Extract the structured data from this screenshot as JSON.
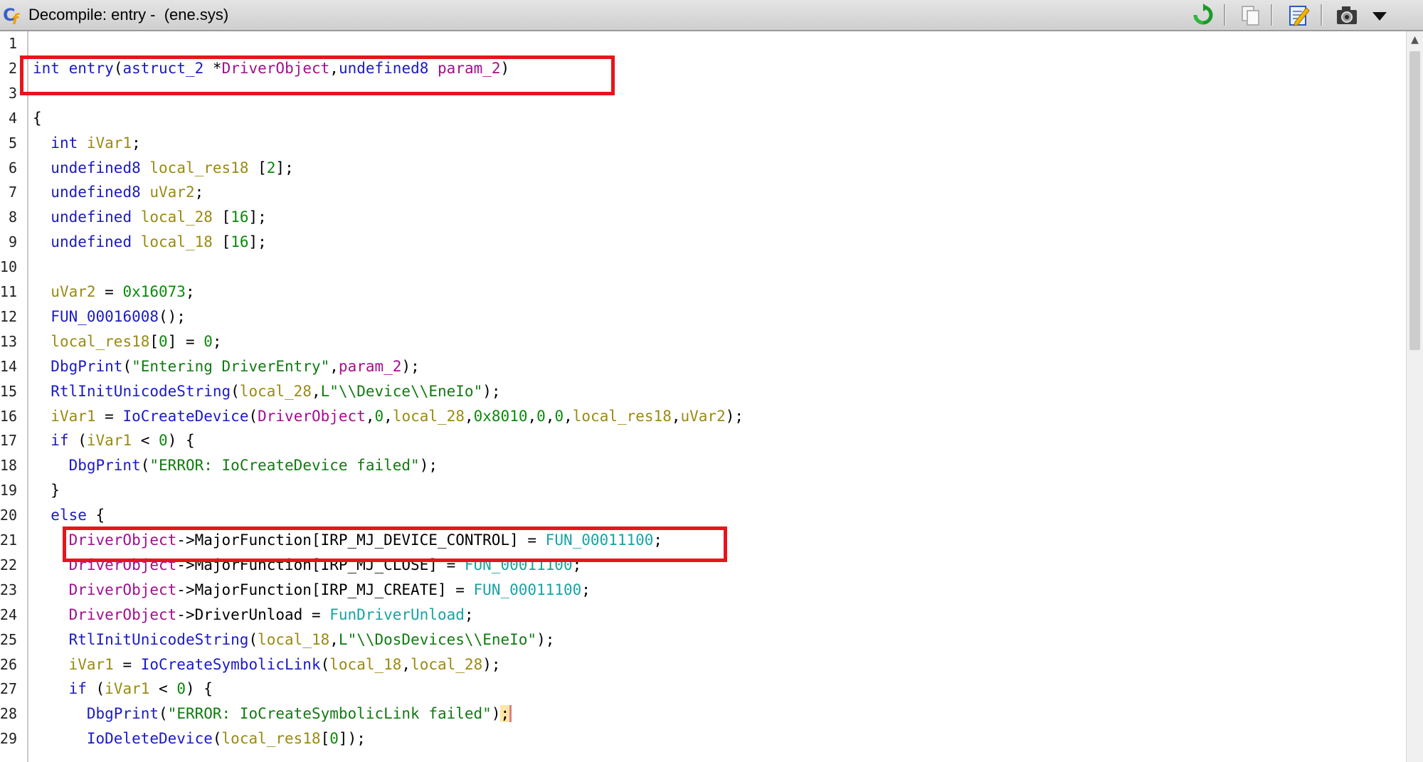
{
  "window": {
    "title": "Decompile: entry -  (ene.sys)"
  },
  "toolbar": {
    "icons": [
      "refresh-icon",
      "copy-icon",
      "edit-icon",
      "snapshot-icon",
      "menu-dropdown-icon"
    ]
  },
  "editor": {
    "line_numbers": [
      "1",
      "2",
      "3",
      "4",
      "5",
      "6",
      "7",
      "8",
      "9",
      "10",
      "11",
      "12",
      "13",
      "14",
      "15",
      "16",
      "17",
      "18",
      "19",
      "20",
      "21",
      "22",
      "23",
      "24",
      "25",
      "26",
      "27",
      "28",
      "29"
    ],
    "lines": [
      [],
      [
        [
          "int",
          "kw"
        ],
        [
          " ",
          "plain"
        ],
        [
          "entry",
          "fn"
        ],
        [
          "(",
          "plain"
        ],
        [
          "astruct_2",
          "type"
        ],
        [
          " *",
          "plain"
        ],
        [
          "DriverObject",
          "param"
        ],
        [
          ",",
          "plain"
        ],
        [
          "undefined8",
          "type"
        ],
        [
          " ",
          "plain"
        ],
        [
          "param_2",
          "param"
        ],
        [
          ")",
          "plain"
        ]
      ],
      [],
      [
        [
          "{",
          "plain"
        ]
      ],
      [
        [
          "  ",
          "plain"
        ],
        [
          "int",
          "kw"
        ],
        [
          " ",
          "plain"
        ],
        [
          "iVar1",
          "var"
        ],
        [
          ";",
          "plain"
        ]
      ],
      [
        [
          "  ",
          "plain"
        ],
        [
          "undefined8",
          "type"
        ],
        [
          " ",
          "plain"
        ],
        [
          "local_res18",
          "var"
        ],
        [
          " [",
          "plain"
        ],
        [
          "2",
          "num"
        ],
        [
          "];",
          "plain"
        ]
      ],
      [
        [
          "  ",
          "plain"
        ],
        [
          "undefined8",
          "type"
        ],
        [
          " ",
          "plain"
        ],
        [
          "uVar2",
          "var"
        ],
        [
          ";",
          "plain"
        ]
      ],
      [
        [
          "  ",
          "plain"
        ],
        [
          "undefined",
          "type"
        ],
        [
          " ",
          "plain"
        ],
        [
          "local_28",
          "var"
        ],
        [
          " [",
          "plain"
        ],
        [
          "16",
          "num"
        ],
        [
          "];",
          "plain"
        ]
      ],
      [
        [
          "  ",
          "plain"
        ],
        [
          "undefined",
          "type"
        ],
        [
          " ",
          "plain"
        ],
        [
          "local_18",
          "var"
        ],
        [
          " [",
          "plain"
        ],
        [
          "16",
          "num"
        ],
        [
          "];",
          "plain"
        ]
      ],
      [],
      [
        [
          "  ",
          "plain"
        ],
        [
          "uVar2",
          "var"
        ],
        [
          " = ",
          "plain"
        ],
        [
          "0x16073",
          "num"
        ],
        [
          ";",
          "plain"
        ]
      ],
      [
        [
          "  ",
          "plain"
        ],
        [
          "FUN_00016008",
          "fn"
        ],
        [
          "();",
          "plain"
        ]
      ],
      [
        [
          "  ",
          "plain"
        ],
        [
          "local_res18",
          "var"
        ],
        [
          "[",
          "plain"
        ],
        [
          "0",
          "num"
        ],
        [
          "] = ",
          "plain"
        ],
        [
          "0",
          "num"
        ],
        [
          ";",
          "plain"
        ]
      ],
      [
        [
          "  ",
          "plain"
        ],
        [
          "DbgPrint",
          "fn"
        ],
        [
          "(",
          "plain"
        ],
        [
          "\"Entering DriverEntry\"",
          "str"
        ],
        [
          ",",
          "plain"
        ],
        [
          "param_2",
          "param"
        ],
        [
          ");",
          "plain"
        ]
      ],
      [
        [
          "  ",
          "plain"
        ],
        [
          "RtlInitUnicodeString",
          "fn"
        ],
        [
          "(",
          "plain"
        ],
        [
          "local_28",
          "var"
        ],
        [
          ",",
          "plain"
        ],
        [
          "L\"\\\\Device\\\\EneIo\"",
          "str"
        ],
        [
          ");",
          "plain"
        ]
      ],
      [
        [
          "  ",
          "plain"
        ],
        [
          "iVar1",
          "var"
        ],
        [
          " = ",
          "plain"
        ],
        [
          "IoCreateDevice",
          "fn"
        ],
        [
          "(",
          "plain"
        ],
        [
          "DriverObject",
          "param"
        ],
        [
          ",",
          "plain"
        ],
        [
          "0",
          "num"
        ],
        [
          ",",
          "plain"
        ],
        [
          "local_28",
          "var"
        ],
        [
          ",",
          "plain"
        ],
        [
          "0x8010",
          "num"
        ],
        [
          ",",
          "plain"
        ],
        [
          "0",
          "num"
        ],
        [
          ",",
          "plain"
        ],
        [
          "0",
          "num"
        ],
        [
          ",",
          "plain"
        ],
        [
          "local_res18",
          "var"
        ],
        [
          ",",
          "plain"
        ],
        [
          "uVar2",
          "var"
        ],
        [
          ");",
          "plain"
        ]
      ],
      [
        [
          "  ",
          "plain"
        ],
        [
          "if",
          "kw"
        ],
        [
          " (",
          "plain"
        ],
        [
          "iVar1",
          "var"
        ],
        [
          " < ",
          "plain"
        ],
        [
          "0",
          "num"
        ],
        [
          ") {",
          "plain"
        ]
      ],
      [
        [
          "    ",
          "plain"
        ],
        [
          "DbgPrint",
          "fn"
        ],
        [
          "(",
          "plain"
        ],
        [
          "\"ERROR: IoCreateDevice failed\"",
          "str"
        ],
        [
          ");",
          "plain"
        ]
      ],
      [
        [
          "  ",
          "plain"
        ],
        [
          "}",
          "plain"
        ]
      ],
      [
        [
          "  ",
          "plain"
        ],
        [
          "else",
          "kw"
        ],
        [
          " {",
          "plain"
        ]
      ],
      [
        [
          "    ",
          "plain"
        ],
        [
          "DriverObject",
          "param"
        ],
        [
          "->MajorFunction[IRP_MJ_DEVICE_CONTROL] = ",
          "plain"
        ],
        [
          "FUN_00011100",
          "fnref"
        ],
        [
          ";",
          "plain"
        ]
      ],
      [
        [
          "    ",
          "plain"
        ],
        [
          "DriverObject",
          "param"
        ],
        [
          "->MajorFunction[IRP_MJ_CLOSE] = ",
          "plain"
        ],
        [
          "FUN_00011100",
          "fnref"
        ],
        [
          ";",
          "plain"
        ]
      ],
      [
        [
          "    ",
          "plain"
        ],
        [
          "DriverObject",
          "param"
        ],
        [
          "->MajorFunction[IRP_MJ_CREATE] = ",
          "plain"
        ],
        [
          "FUN_00011100",
          "fnref"
        ],
        [
          ";",
          "plain"
        ]
      ],
      [
        [
          "    ",
          "plain"
        ],
        [
          "DriverObject",
          "param"
        ],
        [
          "->DriverUnload = ",
          "plain"
        ],
        [
          "FunDriverUnload",
          "fnref"
        ],
        [
          ";",
          "plain"
        ]
      ],
      [
        [
          "    ",
          "plain"
        ],
        [
          "RtlInitUnicodeString",
          "fn"
        ],
        [
          "(",
          "plain"
        ],
        [
          "local_18",
          "var"
        ],
        [
          ",",
          "plain"
        ],
        [
          "L\"\\\\DosDevices\\\\EneIo\"",
          "str"
        ],
        [
          ");",
          "plain"
        ]
      ],
      [
        [
          "    ",
          "plain"
        ],
        [
          "iVar1",
          "var"
        ],
        [
          " = ",
          "plain"
        ],
        [
          "IoCreateSymbolicLink",
          "fn"
        ],
        [
          "(",
          "plain"
        ],
        [
          "local_18",
          "var"
        ],
        [
          ",",
          "plain"
        ],
        [
          "local_28",
          "var"
        ],
        [
          ");",
          "plain"
        ]
      ],
      [
        [
          "    ",
          "plain"
        ],
        [
          "if",
          "kw"
        ],
        [
          " (",
          "plain"
        ],
        [
          "iVar1",
          "var"
        ],
        [
          " < ",
          "plain"
        ],
        [
          "0",
          "num"
        ],
        [
          ") {",
          "plain"
        ]
      ],
      [
        [
          "      ",
          "plain"
        ],
        [
          "DbgPrint",
          "fn"
        ],
        [
          "(",
          "plain"
        ],
        [
          "\"ERROR: IoCreateSymbolicLink failed\"",
          "str"
        ],
        [
          ")",
          "plain"
        ],
        [
          ";",
          "cursor"
        ]
      ],
      [
        [
          "      ",
          "plain"
        ],
        [
          "IoDeleteDevice",
          "fn"
        ],
        [
          "(",
          "plain"
        ],
        [
          "local_res18",
          "var"
        ],
        [
          "[",
          "plain"
        ],
        [
          "0",
          "num"
        ],
        [
          "]);",
          "plain"
        ]
      ]
    ]
  },
  "colors": {
    "highlight_box": "#e8141c",
    "keyword": "#1b1bbd",
    "parameter": "#a40e8e",
    "variable": "#9a8a12",
    "number": "#0a8a0a",
    "string": "#117a11",
    "function_ref": "#17a3a3"
  }
}
